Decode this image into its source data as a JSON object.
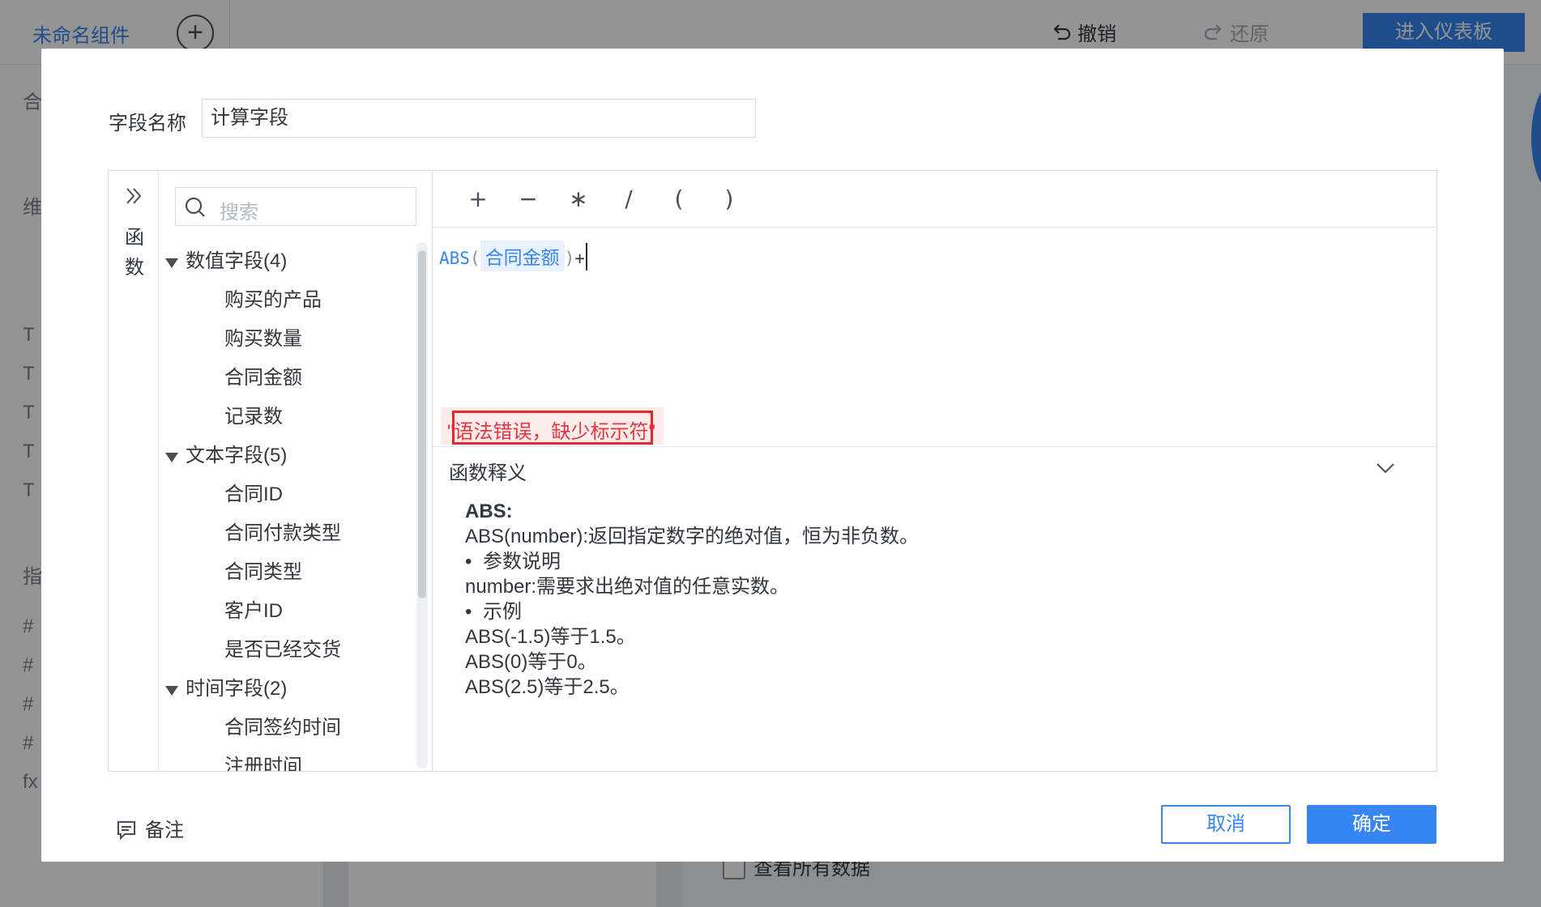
{
  "background": {
    "tab_title": "未命名组件",
    "undo_label": "撤销",
    "redo_label": "还原",
    "dashboard_button": "进入仪表板",
    "sidebar_fragments": [
      "合",
      "维",
      "T",
      "T",
      "T",
      "T",
      "T",
      "指",
      "#",
      "#",
      "#",
      "#",
      "fx"
    ],
    "show_all_data_label": "查看所有数据"
  },
  "dialog": {
    "field_name_label": "字段名称",
    "field_name_value": "计算字段",
    "functions_tab_label": "函数",
    "search_placeholder": "搜索",
    "operators": [
      "+",
      "−",
      "∗",
      "/",
      "(",
      ")"
    ],
    "formula": {
      "function": "ABS",
      "open_paren": "(",
      "field": "合同金额",
      "close_paren": ")",
      "operator": "+"
    },
    "error_message": "\"语法错误，缺少标示符\"",
    "field_groups": [
      {
        "label": "数值字段(4)",
        "items": [
          "购买的产品",
          "购买数量",
          "合同金额",
          "记录数"
        ]
      },
      {
        "label": "文本字段(5)",
        "items": [
          "合同ID",
          "合同付款类型",
          "合同类型",
          "客户ID",
          "是否已经交货"
        ]
      },
      {
        "label": "时间字段(2)",
        "items": [
          "合同签约时间",
          "注册时间"
        ]
      }
    ],
    "explanation": {
      "title": "函数释义",
      "function_name": "ABS:",
      "description": "ABS(number):返回指定数字的绝对值，恒为非负数。",
      "params_heading": "参数说明",
      "param_detail": "number:需要求出绝对值的任意实数。",
      "examples_heading": "示例",
      "examples": [
        "ABS(-1.5)等于1.5。",
        "ABS(0)等于0。",
        "ABS(2.5)等于2.5。"
      ]
    },
    "note_label": "备注",
    "cancel_label": "取消",
    "confirm_label": "确定"
  },
  "colors": {
    "accent": "#3685f2",
    "error": "#e8262e",
    "overlay": "rgba(0,0,0,0.42)"
  }
}
